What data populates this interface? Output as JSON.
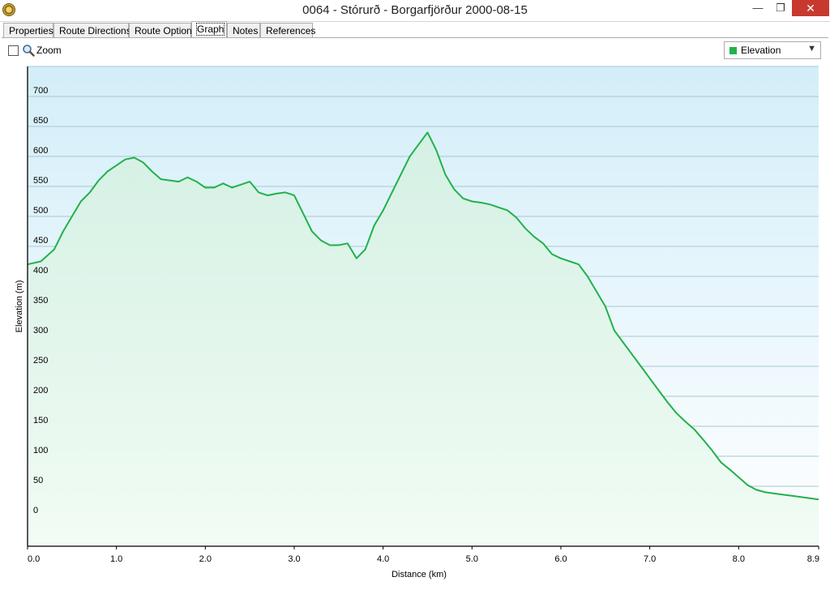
{
  "window": {
    "title": "0064 - Stórurð - Borgarfjörður 2000-08-15",
    "minimize_glyph": "—",
    "restore_glyph": "❐",
    "close_glyph": "✕"
  },
  "tabs": [
    {
      "label": "Properties"
    },
    {
      "label": "Route Directions"
    },
    {
      "label": "Route Options"
    },
    {
      "label": "Graph",
      "active": true
    },
    {
      "label": "Notes"
    },
    {
      "label": "References"
    }
  ],
  "toolbar": {
    "zoom_label": "Zoom",
    "zoom_checked": false,
    "zoom_icon": "magnifier-icon",
    "series_select": "Elevation",
    "series_color": "#22b14c"
  },
  "chart_data": {
    "type": "area",
    "xlabel": "Distance  (km)",
    "ylabel": "Elevation (m)",
    "xlim": [
      0,
      8.9
    ],
    "ylim": [
      -50,
      750
    ],
    "x_ticks": [
      "0.0",
      "1.0",
      "2.0",
      "3.0",
      "4.0",
      "5.0",
      "6.0",
      "7.0",
      "8.0",
      "8.9"
    ],
    "y_ticks": [
      "0",
      "50",
      "100",
      "150",
      "200",
      "250",
      "300",
      "350",
      "400",
      "450",
      "500",
      "550",
      "600",
      "650",
      "700"
    ],
    "grid": true,
    "line_color": "#22b14c",
    "series": [
      {
        "x": [
          0,
          0.15,
          0.3,
          0.4,
          0.5,
          0.6,
          0.7,
          0.8,
          0.9,
          1.0,
          1.1,
          1.2,
          1.3,
          1.4,
          1.5,
          1.6,
          1.7,
          1.8,
          1.9,
          2.0,
          2.1,
          2.2,
          2.3,
          2.4,
          2.5,
          2.6,
          2.7,
          2.8,
          2.9,
          3.0,
          3.1,
          3.2,
          3.3,
          3.4,
          3.5,
          3.6,
          3.7,
          3.8,
          3.9,
          4.0,
          4.1,
          4.2,
          4.3,
          4.4,
          4.5,
          4.6,
          4.7,
          4.8,
          4.9,
          5.0,
          5.1,
          5.2,
          5.3,
          5.4,
          5.5,
          5.6,
          5.7,
          5.8,
          5.9,
          6.0,
          6.1,
          6.2,
          6.3,
          6.4,
          6.5,
          6.6,
          6.7,
          6.8,
          6.9,
          7.0,
          7.1,
          7.2,
          7.3,
          7.4,
          7.5,
          7.6,
          7.7,
          7.8,
          7.9,
          8.0,
          8.1,
          8.2,
          8.3,
          8.4,
          8.5,
          8.6,
          8.7,
          8.8,
          8.9
        ],
        "y": [
          420,
          425,
          445,
          475,
          500,
          525,
          540,
          560,
          575,
          585,
          595,
          598,
          590,
          575,
          562,
          560,
          558,
          565,
          558,
          548,
          548,
          555,
          548,
          553,
          558,
          540,
          535,
          538,
          540,
          535,
          505,
          475,
          460,
          452,
          452,
          455,
          430,
          445,
          485,
          510,
          540,
          570,
          600,
          620,
          640,
          610,
          570,
          545,
          530,
          525,
          523,
          520,
          515,
          510,
          498,
          480,
          466,
          455,
          437,
          430,
          425,
          420,
          400,
          375,
          350,
          310,
          290,
          270,
          250,
          230,
          210,
          190,
          172,
          158,
          145,
          128,
          110,
          90,
          78,
          65,
          52,
          44,
          40,
          38,
          36,
          34,
          32,
          30,
          28
        ]
      }
    ]
  }
}
